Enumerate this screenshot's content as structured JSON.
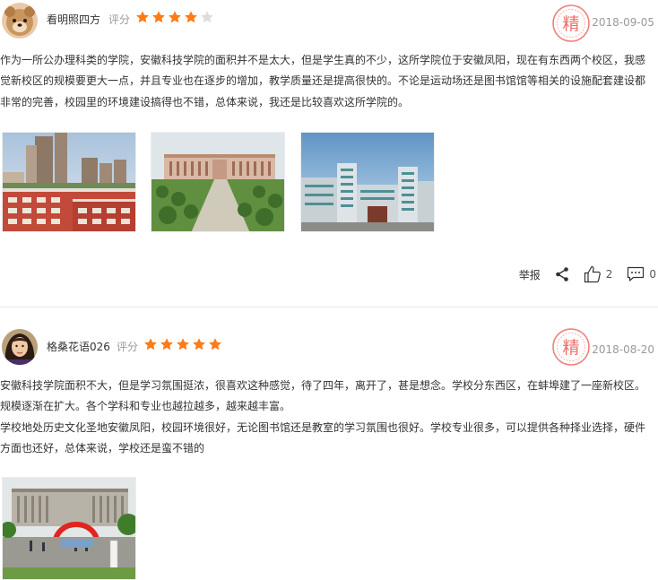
{
  "reviews": [
    {
      "username": "看明照四方",
      "rating_label": "评分",
      "rating": 4,
      "rating_max": 5,
      "badge": "精",
      "date": "2018-09-05",
      "paragraphs": [
        "作为一所公办理科类的学院，安徽科技学院的面积并不是太大，但是学生真的不少，这所学院位于安徽凤阳，现在有东西两个校区，我感觉新校区的规模要更大一点，并且专业也在逐步的增加，教学质量还是提高很快的。不论是运动场还是图书馆馆等相关的设施配套建设都非常的完善，校园里的环境建设搞得也不错，总体来说，我还是比较喜欢这所学院的。"
      ],
      "actions": {
        "report": "举报",
        "likes": "2",
        "comments": "0"
      }
    },
    {
      "username": "格桑花语026",
      "rating_label": "评分",
      "rating": 5,
      "rating_max": 5,
      "badge": "精",
      "date": "2018-08-20",
      "paragraphs": [
        "安徽科技学院面积不大，但是学习氛围挺浓，很喜欢这种感觉，待了四年，离开了，甚是想念。学校分东西区，在蚌埠建了一座新校区。规模逐渐在扩大。各个学科和专业也越拉越多，越来越丰富。",
        "学校地处历史文化圣地安徽凤阳，校园环境很好，无论图书馆还是教室的学习氛围也很好。学校专业很多，可以提供各种择业选择，硬件方面也还好，总体来说，学校还是蛮不错的"
      ]
    }
  ],
  "colors": {
    "star_on": "#ff7a18",
    "star_off": "#dddddd",
    "seal": "#e8574e",
    "date": "#999999",
    "text": "#333333"
  }
}
